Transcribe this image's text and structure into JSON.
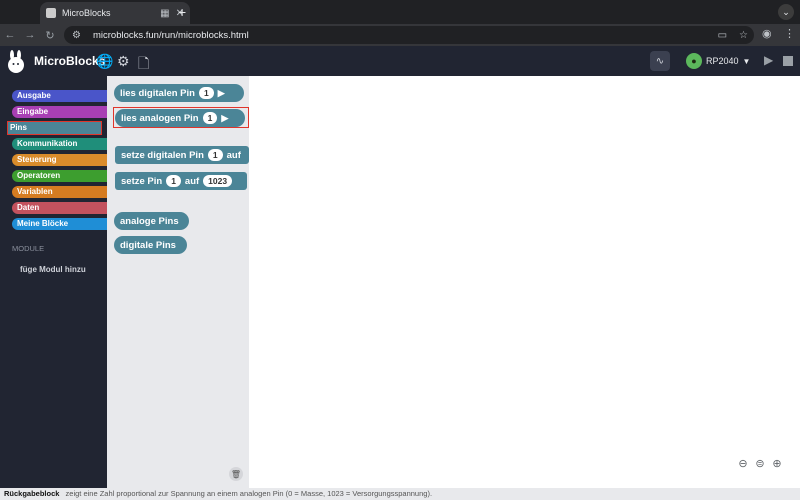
{
  "browser": {
    "tab_title": "MicroBlocks",
    "url": "microblocks.fun/run/microblocks.html"
  },
  "app": {
    "brand": "MicroBlocks",
    "board_name": "RP2040"
  },
  "categories": [
    {
      "label": "Ausgabe",
      "color": "#4a55c9"
    },
    {
      "label": "Eingabe",
      "color": "#a83fb4"
    },
    {
      "label": "Pins",
      "color": "#4b8597"
    },
    {
      "label": "Kommunikation",
      "color": "#1f8e7a"
    },
    {
      "label": "Steuerung",
      "color": "#d98c2b"
    },
    {
      "label": "Operatoren",
      "color": "#3d9e2f"
    },
    {
      "label": "Variablen",
      "color": "#d67c21"
    },
    {
      "label": "Daten",
      "color": "#c3525e"
    },
    {
      "label": "Meine Blöcke",
      "color": "#1f8ed6"
    }
  ],
  "modules": {
    "header": "MODULE",
    "add": "füge Modul hinzu"
  },
  "palette": {
    "read_digital": {
      "text": "lies digitalen Pin",
      "arg": "1"
    },
    "read_analog": {
      "text": "lies analogen Pin",
      "arg": "1"
    },
    "set_digital": {
      "text": "setze digitalen Pin",
      "arg": "1",
      "tail": "auf"
    },
    "set_pin": {
      "text": "setze Pin",
      "arg": "1",
      "mid": "auf",
      "value": "1023"
    },
    "analog_pins": "analoge Pins",
    "digital_pins": "digitale Pins"
  },
  "footer": {
    "title": "Rückgabeblock",
    "text": "zeigt eine Zahl proportional zur Spannung an einem analogen Pin (0 = Masse, 1023 = Versorgungsspannung)."
  }
}
